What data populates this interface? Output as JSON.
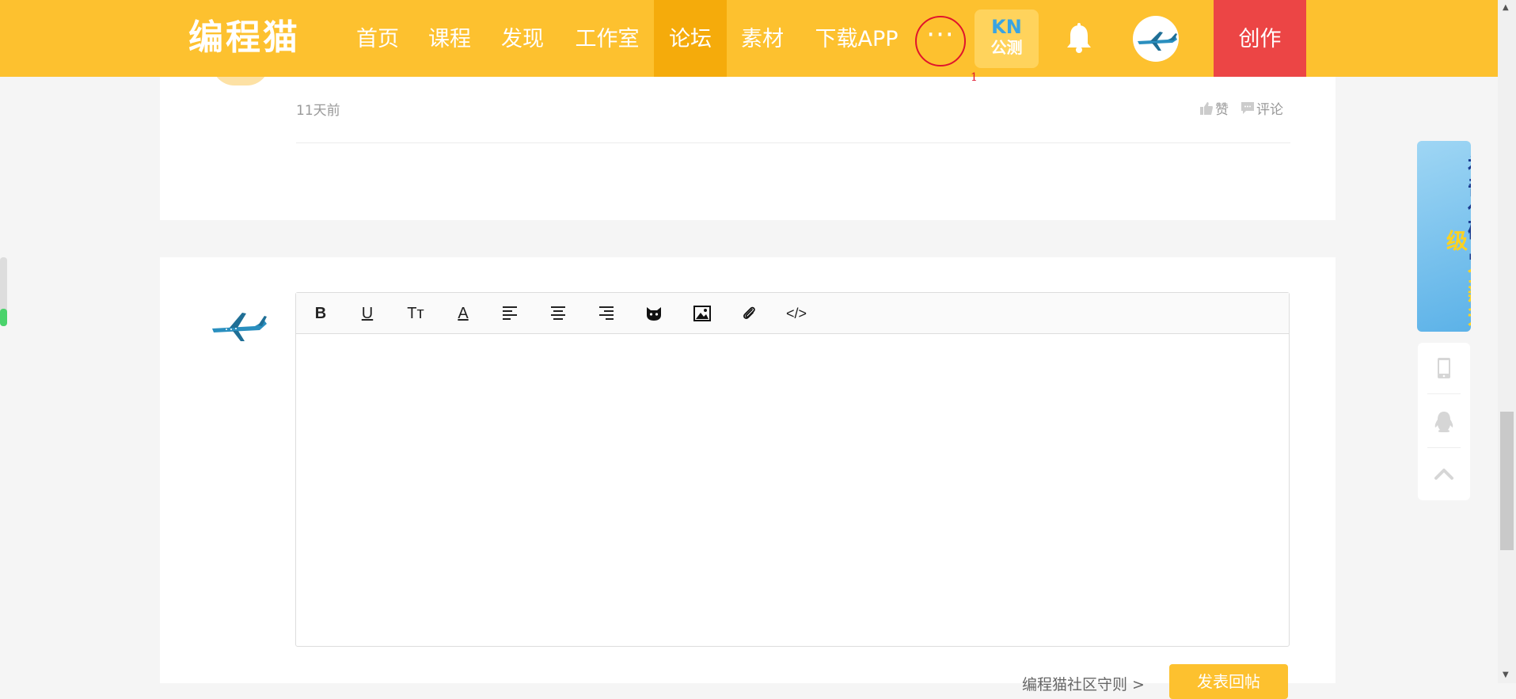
{
  "nav": {
    "logo": "编程猫",
    "items": [
      {
        "label": "首页"
      },
      {
        "label": "课程"
      },
      {
        "label": "发现"
      },
      {
        "label": "工作室"
      },
      {
        "label": "论坛",
        "active": true
      },
      {
        "label": "素材"
      },
      {
        "label": "下载APP"
      }
    ],
    "more_label": "···",
    "more_mark": "1",
    "kn_top": "KN",
    "kn_bottom": "公测",
    "create_label": "创作"
  },
  "post": {
    "time": "11天前",
    "like_label": "赞",
    "comment_label": "评论"
  },
  "editor": {
    "tools": [
      {
        "name": "bold-button",
        "glyph": "B"
      },
      {
        "name": "underline-button",
        "glyph": "U"
      },
      {
        "name": "font-size-button",
        "glyph": "Tт"
      },
      {
        "name": "font-color-button",
        "glyph": "A"
      },
      {
        "name": "align-left-button",
        "icon": "align-left-icon"
      },
      {
        "name": "align-center-button",
        "icon": "align-center-icon"
      },
      {
        "name": "align-right-button",
        "icon": "align-right-icon"
      },
      {
        "name": "emoji-button",
        "icon": "cat-face-icon"
      },
      {
        "name": "image-button",
        "icon": "image-icon"
      },
      {
        "name": "attachment-button",
        "icon": "paperclip-icon"
      },
      {
        "name": "code-button",
        "glyph": "</>"
      }
    ],
    "rules_link": "编程猫社区守则 >",
    "submit_label": "发表回帖"
  },
  "sidebar": {
    "banner_main": "神奇代码岛",
    "banner_highlight": "全新升级",
    "icons": [
      "tablet-icon",
      "qq-penguin-icon",
      "chevron-up-icon"
    ]
  },
  "colors": {
    "nav_bg": "#fdc12f",
    "nav_active": "#f5ab0b",
    "create_bg": "#ec4545",
    "accent_red": "#e0142c"
  }
}
